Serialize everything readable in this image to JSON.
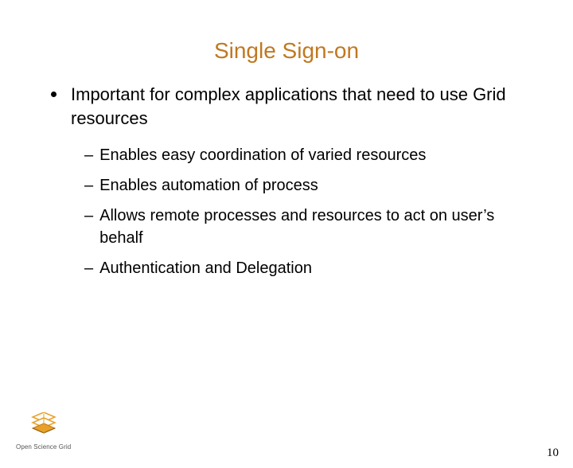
{
  "title": "Single Sign-on",
  "bullet": "Important for complex applications that need to use Grid resources",
  "subs": [
    "Enables easy coordination of varied resources",
    "Enables automation of process",
    "Allows remote processes and resources to act on user’s behalf",
    "Authentication and Delegation"
  ],
  "logo_label": "Open Science Grid",
  "page_number": "10"
}
